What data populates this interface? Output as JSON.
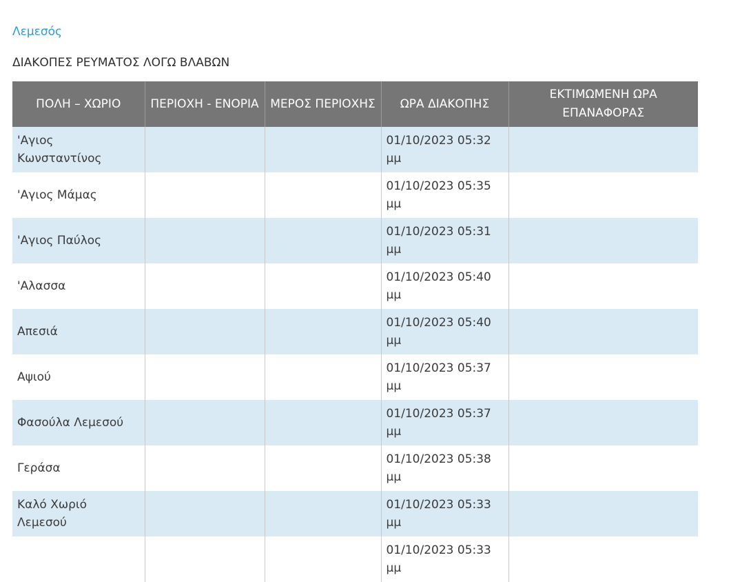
{
  "region": "Λεμεσός",
  "section_title": "ΔΙΑΚΟΠΕΣ ΡΕΥΜΑΤΟΣ ΛΟΓΩ ΒΛΑΒΩΝ",
  "columns": [
    "ΠΟΛΗ – ΧΩΡΙΟ",
    "ΠΕΡΙΟΧΗ - ΕΝΟΡΙΑ",
    "ΜΕΡΟΣ ΠΕΡΙΟΧΗΣ",
    "ΩΡΑ ΔΙΑΚΟΠΗΣ",
    "ΕΚΤΙΜΩΜΕΝΗ ΩΡΑ ΕΠΑΝΑΦΟΡΑΣ"
  ],
  "rows": [
    {
      "town": "'Αγιος Κωνσταντίνος",
      "parish": "",
      "part": "",
      "outage_time": "01/10/2023 05:32 μμ",
      "restore_time": ""
    },
    {
      "town": "'Αγιος Μάμας",
      "parish": "",
      "part": "",
      "outage_time": "01/10/2023 05:35 μμ",
      "restore_time": ""
    },
    {
      "town": "'Αγιος Παύλος",
      "parish": "",
      "part": "",
      "outage_time": "01/10/2023 05:31 μμ",
      "restore_time": ""
    },
    {
      "town": "'Αλασσα",
      "parish": "",
      "part": "",
      "outage_time": "01/10/2023 05:40 μμ",
      "restore_time": ""
    },
    {
      "town": "Απεσιά",
      "parish": "",
      "part": "",
      "outage_time": "01/10/2023 05:40 μμ",
      "restore_time": ""
    },
    {
      "town": "Αψιού",
      "parish": "",
      "part": "",
      "outage_time": "01/10/2023 05:37 μμ",
      "restore_time": ""
    },
    {
      "town": "Φασούλα Λεμεσού",
      "parish": "",
      "part": "",
      "outage_time": "01/10/2023 05:37 μμ",
      "restore_time": ""
    },
    {
      "town": "Γεράσα",
      "parish": "",
      "part": "",
      "outage_time": "01/10/2023 05:38 μμ",
      "restore_time": ""
    },
    {
      "town": "Καλό Χωριό Λεμεσού",
      "parish": "",
      "part": "",
      "outage_time": "01/10/2023 05:33 μμ",
      "restore_time": ""
    },
    {
      "town": "",
      "parish": "",
      "part": "",
      "outage_time": "01/10/2023 05:33 μμ",
      "restore_time": ""
    }
  ]
}
